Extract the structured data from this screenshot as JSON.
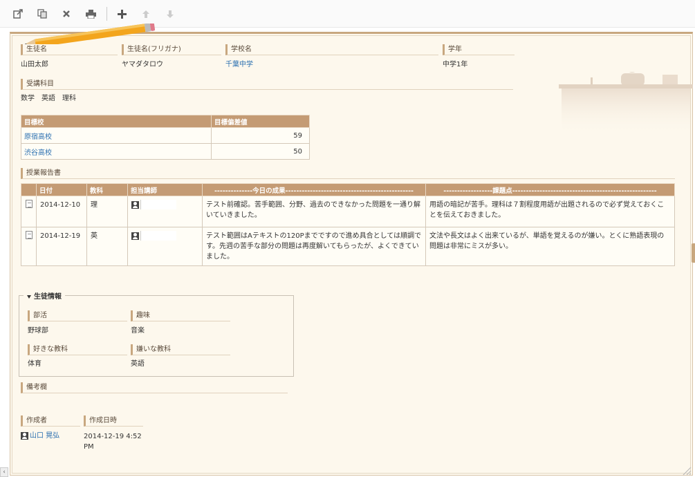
{
  "student": {
    "name_label": "生徒名",
    "name": "山田太郎",
    "kana_label": "生徒名(フリガナ)",
    "kana": "ヤマダタロウ",
    "school_label": "学校名",
    "school": "千葉中学",
    "grade_label": "学年",
    "grade": "中学1年"
  },
  "subjects": {
    "label": "受講科目",
    "value": "数学　英語　理科"
  },
  "target": {
    "col_school": "目標校",
    "col_score": "目標偏差値",
    "rows": [
      {
        "school": "原宿高校",
        "score": "59"
      },
      {
        "school": "渋谷高校",
        "score": "50"
      }
    ]
  },
  "report": {
    "label": "授業報告書",
    "col_date": "日付",
    "col_subject": "教科",
    "col_teacher": "担当講師",
    "col_result": "--------------今日の成果-----------------------------------------------",
    "col_issue": "------------------課題点-----------------------------------------------------",
    "rows": [
      {
        "date": "2014-12-10",
        "subject": "理",
        "result": "テスト前確認。苦手範囲、分野、過去のできなかった問題を一通り解いていきました。",
        "issue": "用語の暗記が苦手。理科は７割程度用語が出題されるので必ず覚えておくことを伝えておきました。"
      },
      {
        "date": "2014-12-19",
        "subject": "英",
        "result": "テスト範囲はAテキストの120Pまでですので進め具合としては順調です。先週の苦手な部分の問題は再度解いてもらったが、よくできていました。",
        "issue": "文法や長文はよく出来ているが、単語を覚えるのが嫌い。とくに熟語表現の問題は非常にミスが多い。"
      }
    ]
  },
  "info": {
    "legend": "生徒情報",
    "club_label": "部活",
    "club": "野球部",
    "hobby_label": "趣味",
    "hobby": "音楽",
    "like_label": "好きな教科",
    "like": "体育",
    "dislike_label": "嫌いな教科",
    "dislike": "英語"
  },
  "remarks": {
    "label": "備考欄"
  },
  "meta": {
    "author_label": "作成者",
    "author": "山口 晃弘",
    "created_label": "作成日時",
    "created_date": "2014-12-19 4:52",
    "created_ampm": "PM"
  },
  "icons": {
    "toolbar": [
      "edit-icon",
      "copy-icon",
      "delete-icon",
      "print-icon",
      "add-icon",
      "move-up-icon",
      "move-down-icon"
    ]
  },
  "colors": {
    "accent": "#c49b74",
    "paper": "#fdf8ed",
    "link": "#2a6fb0"
  }
}
